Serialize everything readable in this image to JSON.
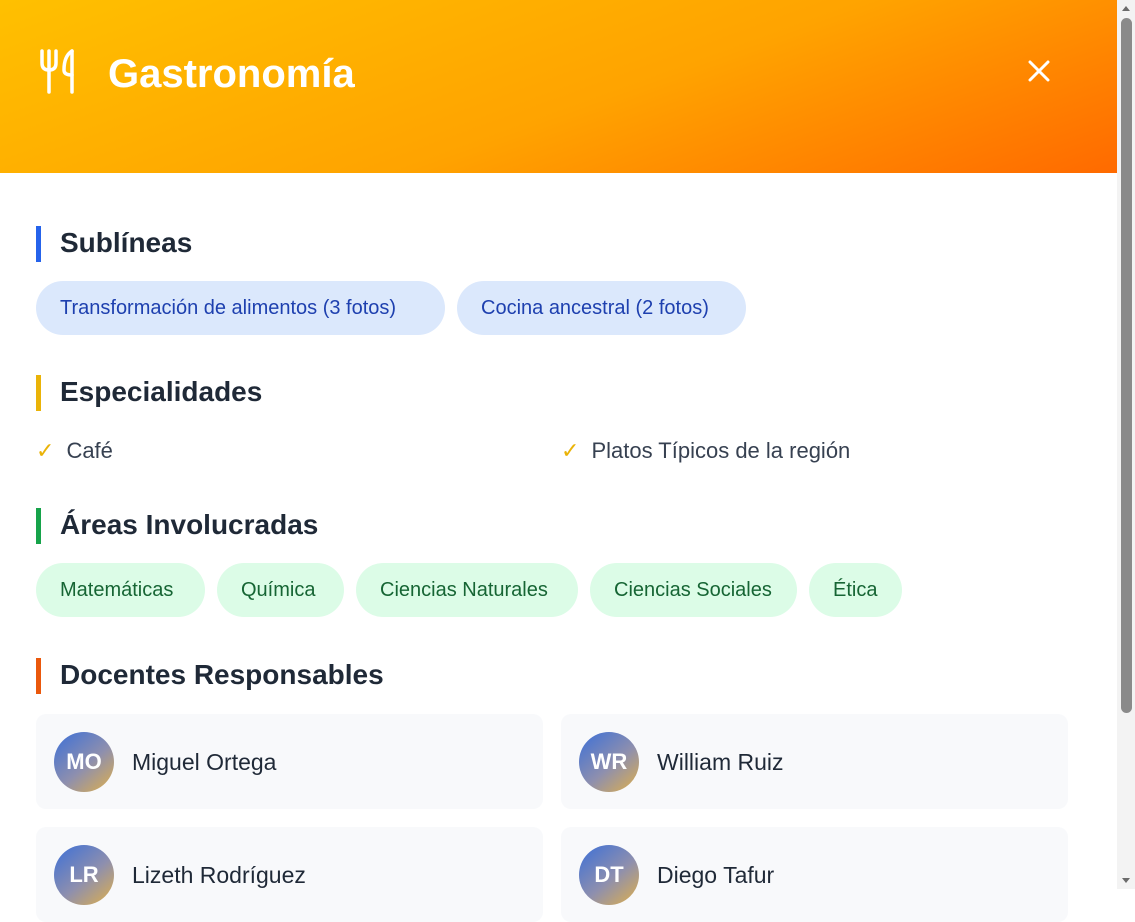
{
  "header": {
    "title": "Gastronomía",
    "icon": "utensils-icon",
    "close_icon": "close-icon",
    "gradient": [
      "#ffc000",
      "#ff6a00"
    ]
  },
  "sublineas": {
    "title": "Sublíneas",
    "accent": "#2563eb",
    "items": [
      "Transformación de alimentos (3 fotos)",
      "Cocina ancestral (2 fotos)"
    ]
  },
  "especialidades": {
    "title": "Especialidades",
    "accent": "#eab308",
    "check": "✓",
    "items": [
      "Café",
      "Platos Típicos de la región"
    ]
  },
  "areas": {
    "title": "Áreas Involucradas",
    "accent": "#16a34a",
    "items": [
      "Matemáticas",
      "Química",
      "Ciencias Naturales",
      "Ciencias Sociales",
      "Ética"
    ]
  },
  "docentes": {
    "title": "Docentes Responsables",
    "accent": "#ea580c",
    "items": [
      {
        "initials": "MO",
        "name": "Miguel Ortega"
      },
      {
        "initials": "WR",
        "name": "William Ruiz"
      },
      {
        "initials": "LR",
        "name": "Lizeth Rodríguez"
      },
      {
        "initials": "DT",
        "name": "Diego Tafur"
      }
    ]
  }
}
